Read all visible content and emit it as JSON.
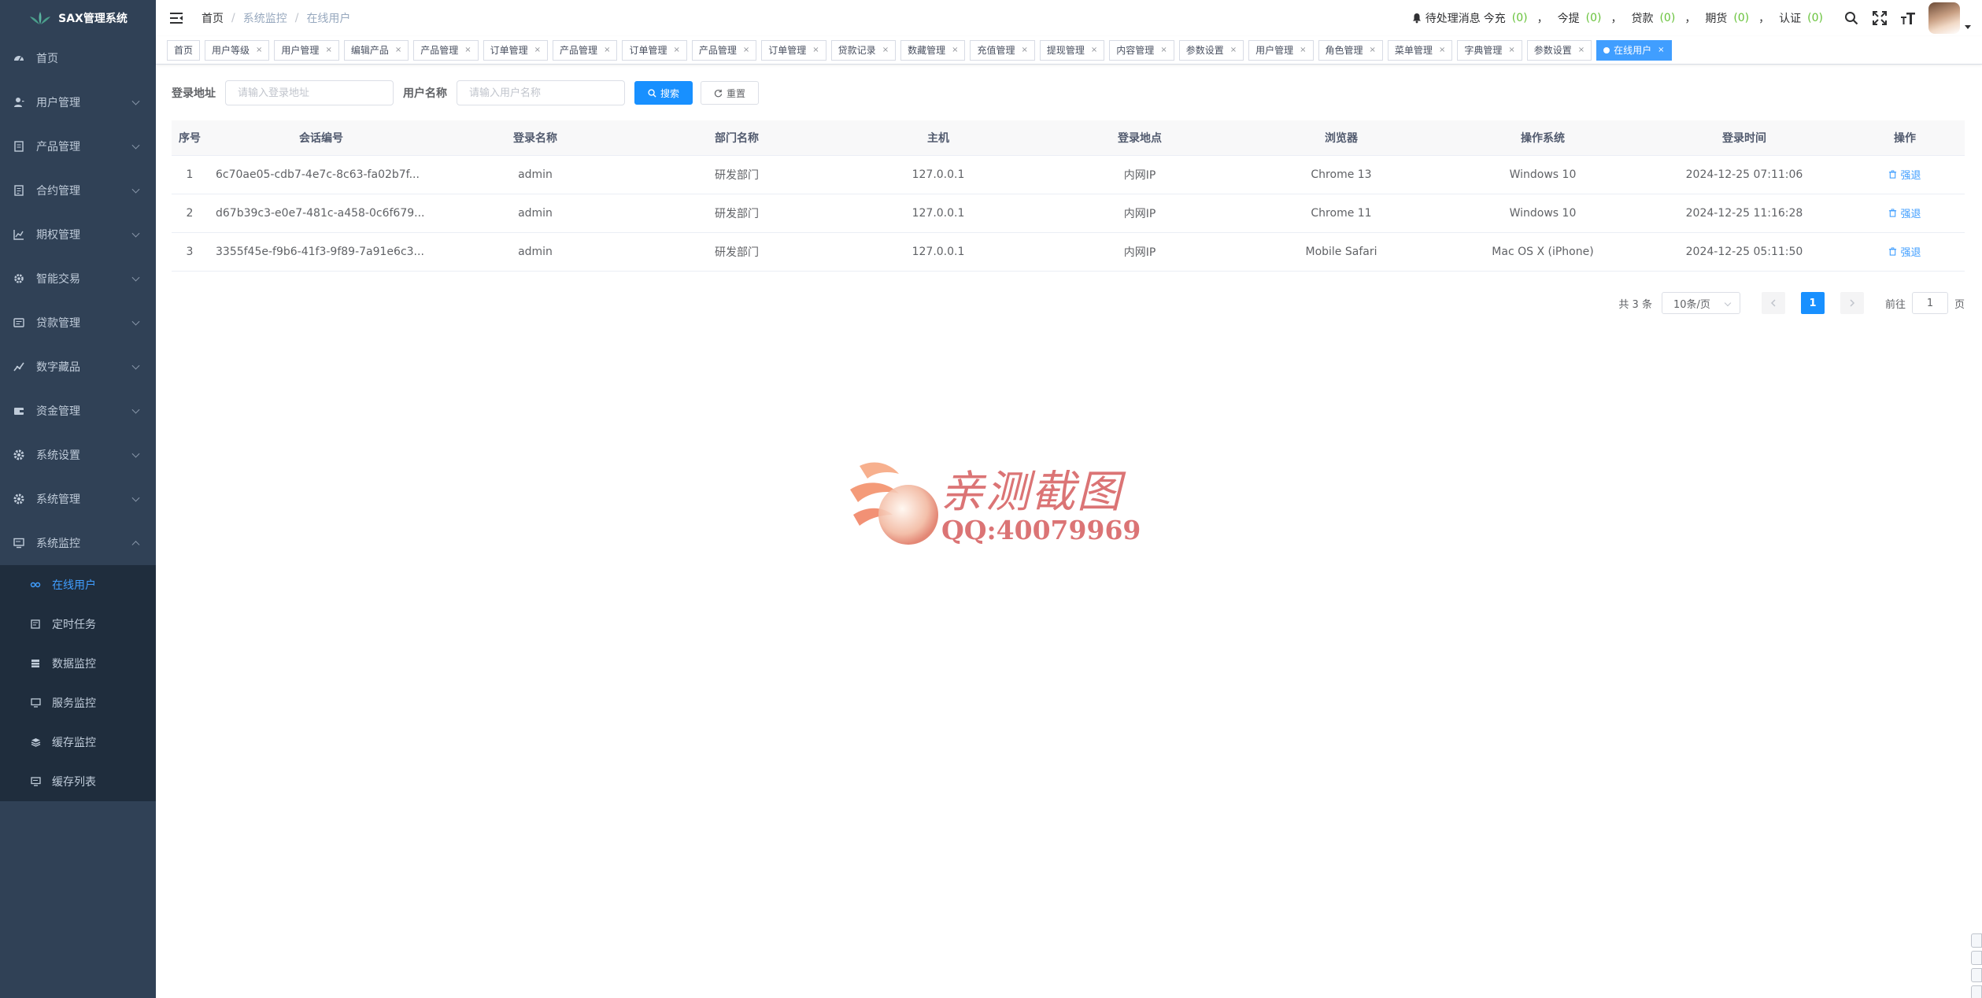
{
  "app": {
    "title": "SAX管理系统",
    "accent_color": "#409eff",
    "sidebar_bg": "#304156"
  },
  "sidebar": {
    "items": [
      {
        "label": "首页",
        "icon": "dashboard-icon",
        "has_children": false
      },
      {
        "label": "用户管理",
        "icon": "user-icon",
        "has_children": true
      },
      {
        "label": "产品管理",
        "icon": "document-icon",
        "has_children": true
      },
      {
        "label": "合约管理",
        "icon": "contract-icon",
        "has_children": true
      },
      {
        "label": "期权管理",
        "icon": "chart-icon",
        "has_children": true
      },
      {
        "label": "智能交易",
        "icon": "gear-icon",
        "has_children": true
      },
      {
        "label": "贷款管理",
        "icon": "loan-icon",
        "has_children": true
      },
      {
        "label": "数字藏品",
        "icon": "trend-icon",
        "has_children": true
      },
      {
        "label": "资金管理",
        "icon": "wallet-icon",
        "has_children": true
      },
      {
        "label": "系统设置",
        "icon": "settings-icon",
        "has_children": true
      },
      {
        "label": "系统管理",
        "icon": "system-icon",
        "has_children": true
      },
      {
        "label": "系统监控",
        "icon": "monitor-icon",
        "has_children": true,
        "expanded": true
      }
    ],
    "submenu": [
      {
        "label": "在线用户",
        "icon": "online-icon",
        "active": true
      },
      {
        "label": "定时任务",
        "icon": "job-icon",
        "active": false
      },
      {
        "label": "数据监控",
        "icon": "database-icon",
        "active": false
      },
      {
        "label": "服务监控",
        "icon": "server-icon",
        "active": false
      },
      {
        "label": "缓存监控",
        "icon": "cache-icon",
        "active": false
      },
      {
        "label": "缓存列表",
        "icon": "list-icon",
        "active": false
      }
    ]
  },
  "navbar": {
    "breadcrumb": [
      "首页",
      "系统监控",
      "在线用户"
    ],
    "messages": {
      "label": "待处理消息",
      "items": [
        {
          "key": "今充",
          "count": "(0)"
        },
        {
          "key": "今提",
          "count": "(0)"
        },
        {
          "key": "贷款",
          "count": "(0)"
        },
        {
          "key": "期货",
          "count": "(0)"
        },
        {
          "key": "认证",
          "count": "(0)"
        }
      ],
      "separator": "，"
    }
  },
  "tags": [
    {
      "label": "首页",
      "closable": false
    },
    {
      "label": "用户等级",
      "closable": true
    },
    {
      "label": "用户管理",
      "closable": true
    },
    {
      "label": "编辑产品",
      "closable": true
    },
    {
      "label": "产品管理",
      "closable": true
    },
    {
      "label": "订单管理",
      "closable": true
    },
    {
      "label": "产品管理",
      "closable": true
    },
    {
      "label": "订单管理",
      "closable": true
    },
    {
      "label": "产品管理",
      "closable": true
    },
    {
      "label": "订单管理",
      "closable": true
    },
    {
      "label": "贷款记录",
      "closable": true
    },
    {
      "label": "数藏管理",
      "closable": true
    },
    {
      "label": "充值管理",
      "closable": true
    },
    {
      "label": "提现管理",
      "closable": true
    },
    {
      "label": "内容管理",
      "closable": true
    },
    {
      "label": "参数设置",
      "closable": true
    },
    {
      "label": "用户管理",
      "closable": true
    },
    {
      "label": "角色管理",
      "closable": true
    },
    {
      "label": "菜单管理",
      "closable": true
    },
    {
      "label": "字典管理",
      "closable": true
    },
    {
      "label": "参数设置",
      "closable": true
    },
    {
      "label": "在线用户",
      "closable": true,
      "active": true
    }
  ],
  "search": {
    "ip_label": "登录地址",
    "ip_placeholder": "请输入登录地址",
    "user_label": "用户名称",
    "user_placeholder": "请输入用户名称",
    "search_btn": "搜索",
    "reset_btn": "重置"
  },
  "table": {
    "columns": [
      "序号",
      "会话编号",
      "登录名称",
      "部门名称",
      "主机",
      "登录地点",
      "浏览器",
      "操作系统",
      "登录时间",
      "操作"
    ],
    "rows": [
      [
        "1",
        "6c70ae05-cdb7-4e7c-8c63-fa02b7f...",
        "admin",
        "研发部门",
        "127.0.0.1",
        "内网IP",
        "Chrome 13",
        "Windows 10",
        "2024-12-25 07:11:06",
        "强退"
      ],
      [
        "2",
        "d67b39c3-e0e7-481c-a458-0c6f679...",
        "admin",
        "研发部门",
        "127.0.0.1",
        "内网IP",
        "Chrome 11",
        "Windows 10",
        "2024-12-25 11:16:28",
        "强退"
      ],
      [
        "3",
        "3355f45e-f9b6-41f3-9f89-7a91e6c3...",
        "admin",
        "研发部门",
        "127.0.0.1",
        "内网IP",
        "Mobile Safari",
        "Mac OS X (iPhone)",
        "2024-12-25 05:11:50",
        "强退"
      ]
    ]
  },
  "pagination": {
    "total_text": "共 3 条",
    "page_size": "10条/页",
    "current_page": "1",
    "goto_prefix": "前往",
    "goto_value": "1",
    "goto_suffix": "页"
  },
  "watermark": {
    "line1": "亲测截图",
    "line2": "QQ:40079969"
  }
}
